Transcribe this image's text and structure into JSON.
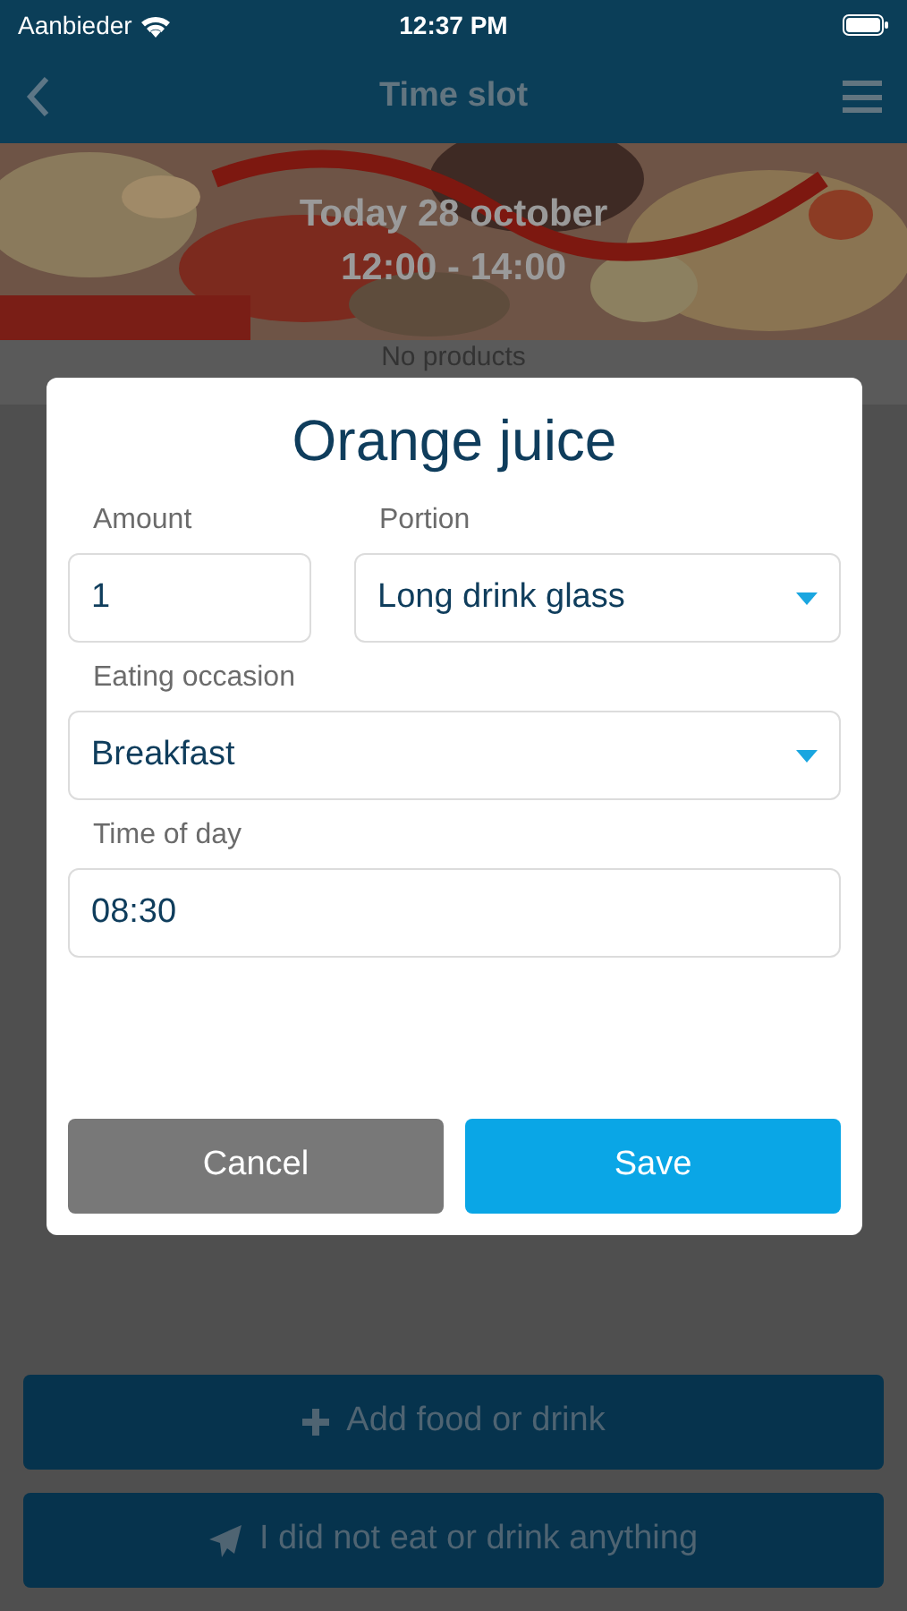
{
  "status_bar": {
    "carrier": "Aanbieder",
    "time": "12:37 PM"
  },
  "nav": {
    "title": "Time slot"
  },
  "header": {
    "date": "Today 28 october",
    "time_range": "12:00 - 14:00"
  },
  "empty_message": "No products",
  "dialog": {
    "title": "Orange juice",
    "fields": [
      {
        "kind": "input",
        "label": "Amount",
        "value": "1"
      },
      {
        "kind": "select",
        "label": "Portion",
        "value": "Long drink glass"
      },
      {
        "kind": "select",
        "label": "Eating occasion",
        "value": "Breakfast"
      },
      {
        "kind": "input",
        "label": "Time of day",
        "value": "08:30"
      }
    ],
    "buttons": [
      {
        "kind": "cancel",
        "label": "Cancel"
      },
      {
        "kind": "save",
        "label": "Save"
      }
    ]
  },
  "actions": [
    {
      "kind": "add",
      "label": "Add food or drink"
    },
    {
      "kind": "none",
      "label": "I did not eat or drink anything"
    }
  ]
}
